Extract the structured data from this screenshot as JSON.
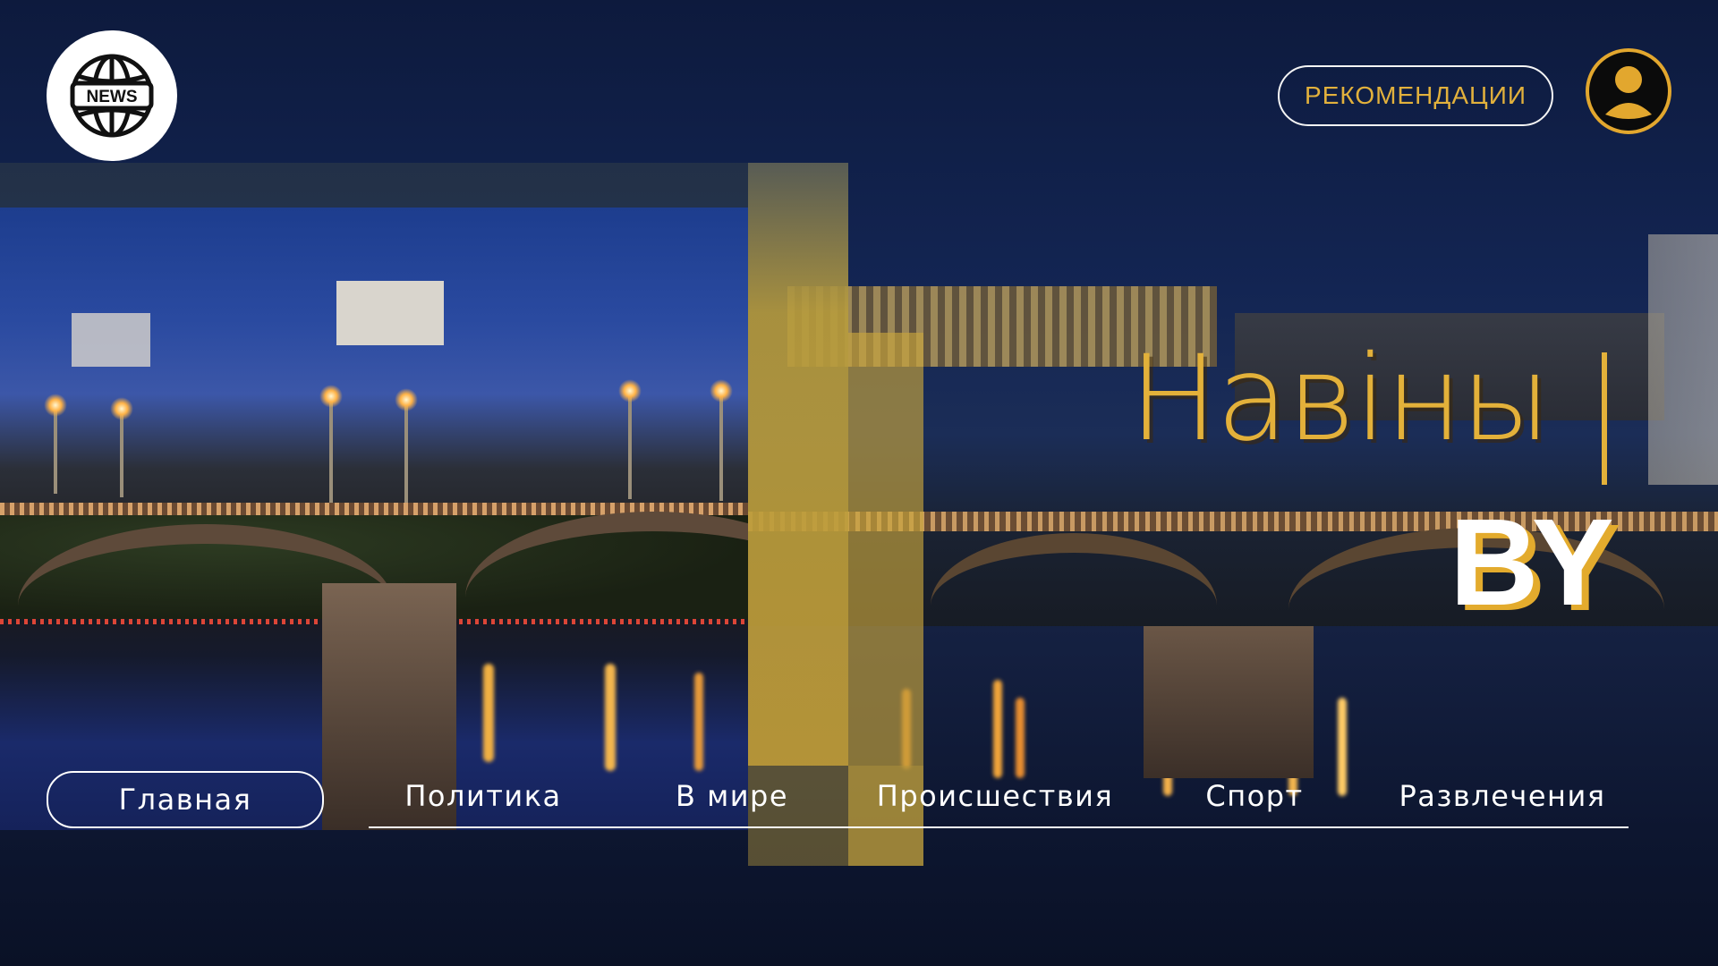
{
  "brand": {
    "logo_text": "NEWS",
    "logo_icon": "globe-icon"
  },
  "header": {
    "recommendations_label": "РЕКОМЕНДАЦИИ",
    "profile_icon": "user-icon"
  },
  "hero": {
    "title": "Навіны",
    "cursor": "|",
    "subtitle": "BY"
  },
  "nav": {
    "items": [
      {
        "label": "Главная",
        "active": true
      },
      {
        "label": "Политика",
        "active": false
      },
      {
        "label": "В мире",
        "active": false
      },
      {
        "label": "Происшествия",
        "active": false
      },
      {
        "label": "Спорт",
        "active": false
      },
      {
        "label": "Развлечения",
        "active": false
      }
    ]
  },
  "colors": {
    "accent_gold": "#e3b13a",
    "text_white": "#ffffff",
    "bg_night_blue": "#0d1a3d"
  }
}
